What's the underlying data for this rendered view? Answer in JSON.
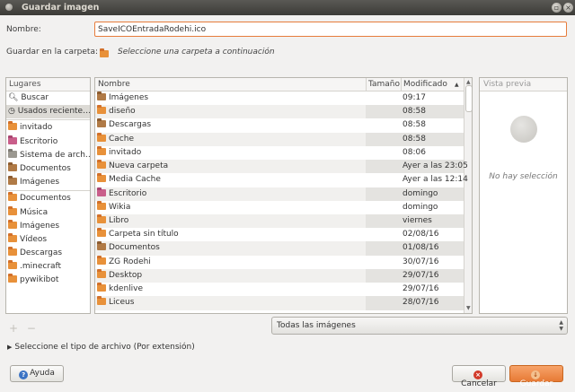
{
  "window": {
    "title": "Guardar imagen",
    "icon": "app-icon"
  },
  "name_label": "Nombre:",
  "name_value": "SaveICOEntradaRodehi.ico",
  "folder_label": "Guardar en la carpeta:",
  "folder_value": "Seleccione una carpeta a continuación",
  "places": {
    "header": "Lugares",
    "group1": [
      {
        "label": "Buscar",
        "icon": "search-icon"
      },
      {
        "label": "Usados reciente…",
        "icon": "recent-icon"
      }
    ],
    "group2": [
      {
        "label": "invitado",
        "icon": "home-folder-icon"
      },
      {
        "label": "Escritorio",
        "icon": "desktop-icon"
      },
      {
        "label": "Sistema de arch…",
        "icon": "drive-icon"
      },
      {
        "label": "Documentos",
        "icon": "folder-icon"
      },
      {
        "label": "Imágenes",
        "icon": "folder-icon"
      }
    ],
    "group3": [
      {
        "label": "Documentos",
        "icon": "folder-icon"
      },
      {
        "label": "Música",
        "icon": "folder-icon"
      },
      {
        "label": "Imágenes",
        "icon": "folder-icon"
      },
      {
        "label": "Vídeos",
        "icon": "folder-icon"
      },
      {
        "label": "Descargas",
        "icon": "folder-icon"
      },
      {
        "label": ".minecraft",
        "icon": "folder-icon"
      },
      {
        "label": "pywikibot",
        "icon": "folder-icon"
      }
    ]
  },
  "files": {
    "columns": {
      "name": "Nombre",
      "size": "Tamaño",
      "modified": "Modificado"
    },
    "rows": [
      {
        "name": "Imágenes",
        "modified": "09:17"
      },
      {
        "name": "diseño",
        "modified": "08:58"
      },
      {
        "name": "Descargas",
        "modified": "08:58"
      },
      {
        "name": "Cache",
        "modified": "08:58"
      },
      {
        "name": "invitado",
        "modified": "08:06"
      },
      {
        "name": "Nueva carpeta",
        "modified": "Ayer a las 23:05"
      },
      {
        "name": "Media Cache",
        "modified": "Ayer a las 12:14"
      },
      {
        "name": "Escritorio",
        "modified": "domingo"
      },
      {
        "name": "Wikia",
        "modified": "domingo"
      },
      {
        "name": "Libro",
        "modified": "viernes"
      },
      {
        "name": "Carpeta sin título",
        "modified": "02/08/16"
      },
      {
        "name": "Documentos",
        "modified": "01/08/16"
      },
      {
        "name": "ZG Rodehi",
        "modified": "30/07/16"
      },
      {
        "name": "Desktop",
        "modified": "29/07/16"
      },
      {
        "name": "kdenlive",
        "modified": "29/07/16"
      },
      {
        "name": "Liceus",
        "modified": "28/07/16"
      }
    ]
  },
  "preview": {
    "header": "Vista previa",
    "empty_text": "No hay selección"
  },
  "add_symbol": "+",
  "remove_symbol": "−",
  "filter_value": "Todas las imágenes",
  "expander_label": "Seleccione el tipo de archivo (Por extensión)",
  "buttons": {
    "help": "Ayuda",
    "cancel": "Cancelar",
    "save": "Guardar"
  }
}
